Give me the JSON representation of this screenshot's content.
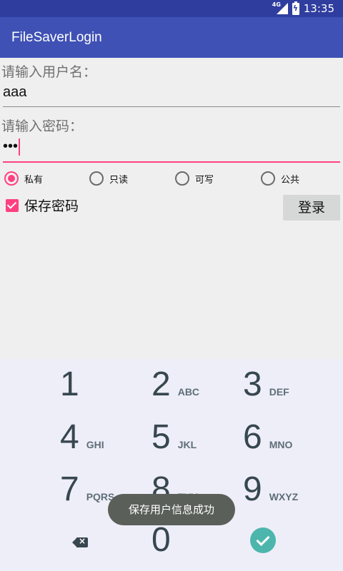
{
  "status_bar": {
    "network": "4G",
    "time": "13:35"
  },
  "app_bar": {
    "title": "FileSaverLogin"
  },
  "form": {
    "username_label": "请输入用户名：",
    "username_value": "aaa",
    "password_label": "请输入密码：",
    "password_value": "•••",
    "modes": [
      {
        "label": "私有",
        "checked": true
      },
      {
        "label": "只读",
        "checked": false
      },
      {
        "label": "可写",
        "checked": false
      },
      {
        "label": "公共",
        "checked": false
      }
    ],
    "save_password_label": "保存密码",
    "save_password_checked": true,
    "login_label": "登录"
  },
  "keypad": {
    "keys": [
      {
        "num": "1",
        "letters": ""
      },
      {
        "num": "2",
        "letters": "ABC"
      },
      {
        "num": "3",
        "letters": "DEF"
      },
      {
        "num": "4",
        "letters": "GHI"
      },
      {
        "num": "5",
        "letters": "JKL"
      },
      {
        "num": "6",
        "letters": "MNO"
      },
      {
        "num": "7",
        "letters": "PQRS"
      },
      {
        "num": "8",
        "letters": "TUV"
      },
      {
        "num": "9",
        "letters": "WXYZ"
      },
      {
        "num": "0",
        "letters": ""
      }
    ],
    "backspace_icon": "backspace-icon",
    "enter_icon": "check-icon",
    "accent_color": "#4db6ac"
  },
  "toast": {
    "message": "保存用户信息成功"
  },
  "colors": {
    "primary": "#3f51b5",
    "primary_dark": "#2f3e9e",
    "accent": "#ff4081"
  }
}
